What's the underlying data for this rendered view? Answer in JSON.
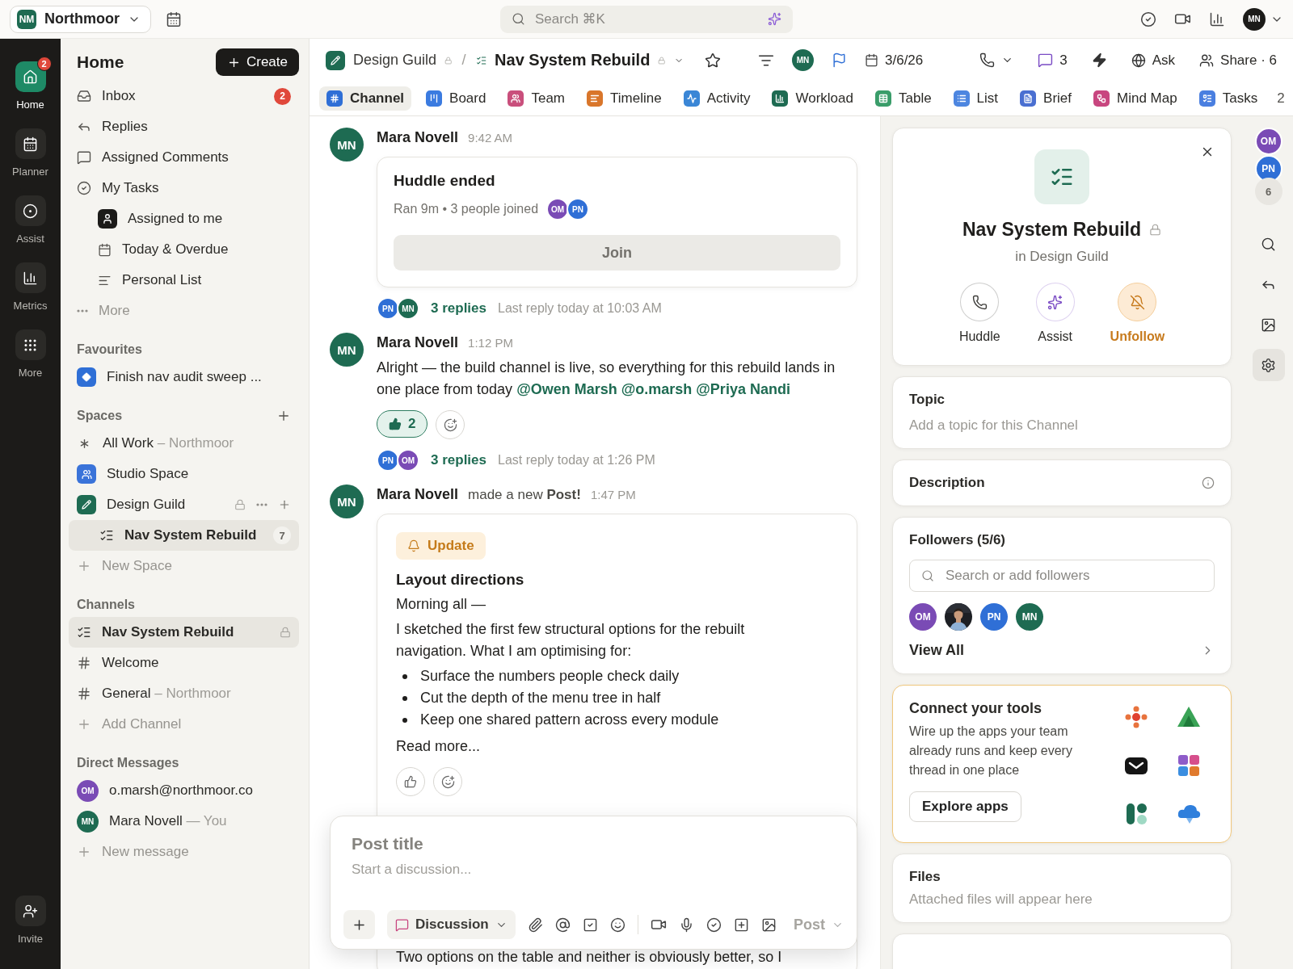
{
  "topbar": {
    "workspace_initials": "NM",
    "workspace_name": "Northmoor",
    "search_placeholder": "Search ⌘K",
    "user_initials": "MN"
  },
  "rail": {
    "items": [
      {
        "label": "Home",
        "selected": true,
        "badge": "2"
      },
      {
        "label": "Planner",
        "selected": false
      },
      {
        "label": "Assist",
        "selected": false
      },
      {
        "label": "Metrics",
        "selected": false
      },
      {
        "label": "More",
        "selected": false
      }
    ],
    "invite": "Invite"
  },
  "sidebar": {
    "title": "Home",
    "create": "Create",
    "nav": [
      {
        "label": "Inbox",
        "badge": "2"
      },
      {
        "label": "Replies"
      },
      {
        "label": "Assigned Comments"
      },
      {
        "label": "My Tasks",
        "children": [
          {
            "label": "Assigned to me"
          },
          {
            "label": "Today & Overdue"
          },
          {
            "label": "Personal List"
          }
        ]
      }
    ],
    "more": "More",
    "favourites": {
      "heading": "Favourites",
      "items": [
        {
          "label": "Finish nav audit sweep ...",
          "color": "#2f6fd6"
        }
      ]
    },
    "spaces": {
      "heading": "Spaces",
      "items": [
        {
          "kind": "all",
          "label": "All Work",
          "suffix": "– Northmoor",
          "selected": false
        },
        {
          "kind": "space",
          "label": "Studio Space",
          "color": "#3a73d9",
          "selected": false
        },
        {
          "kind": "space",
          "label": "Design Guild",
          "color": "#1e6b52",
          "locked": true,
          "selected": false,
          "children": [
            {
              "label": "Nav System Rebuild",
              "count": "7",
              "selected": true
            }
          ]
        }
      ],
      "add": "New Space"
    },
    "channels": {
      "heading": "Channels",
      "items": [
        {
          "kind": "list",
          "label": "Nav System Rebuild",
          "locked": true,
          "selected": true
        },
        {
          "kind": "hash",
          "label": "Welcome",
          "selected": false
        },
        {
          "kind": "hash",
          "label": "General",
          "suffix": "– Northmoor",
          "selected": false
        }
      ],
      "add": "Add Channel"
    },
    "direct_messages": {
      "heading": "Direct Messages",
      "items": [
        {
          "initials": "OM",
          "color": "#7a4bb5",
          "label": "o.marsh@northmoor.co"
        },
        {
          "initials": "MN",
          "color": "#1e6b52",
          "label": "Mara Novell",
          "suffix": "— You"
        }
      ],
      "add": "New message"
    }
  },
  "header": {
    "space": "Design Guild",
    "separator": "/",
    "channel": "Nav System Rebuild",
    "assignee": {
      "initials": "MN",
      "color": "#1e6b52"
    },
    "date": "3/6/26",
    "comments": "3",
    "ask": "Ask",
    "share": "Share · 6",
    "tabs": [
      {
        "label": "Channel",
        "color": "#2f6fd6",
        "selected": true
      },
      {
        "label": "Board",
        "color": "#3b7be0",
        "selected": false
      },
      {
        "label": "Team",
        "color": "#c94f7c",
        "selected": false
      },
      {
        "label": "Timeline",
        "color": "#d9762b",
        "selected": false
      },
      {
        "label": "Activity",
        "color": "#3a86d6",
        "selected": false
      },
      {
        "label": "Workload",
        "color": "#1e6b52",
        "selected": false
      },
      {
        "label": "Table",
        "color": "#3a9d6a",
        "selected": false
      },
      {
        "label": "List",
        "color": "#4d86e0",
        "selected": false
      },
      {
        "label": "Brief",
        "color": "#4a6fd1",
        "selected": false
      },
      {
        "label": "Mind Map",
        "color": "#c8467f",
        "selected": false
      },
      {
        "label": "Tasks",
        "color": "#4a7fe0",
        "selected": false
      }
    ],
    "overflow": "2"
  },
  "messages": [
    {
      "kind": "huddle",
      "author": "Mara Novell",
      "initials": "MN",
      "color": "#1e6b52",
      "time": "9:42 AM",
      "title": "Huddle ended",
      "meta": "Ran 9m • 3 people joined",
      "avatars": [
        {
          "initials": "OM",
          "color": "#7a4bb5"
        },
        {
          "initials": "PN",
          "color": "#2f6fd6"
        }
      ],
      "button": "Join",
      "thread": {
        "avatars": [
          {
            "initials": "PN",
            "color": "#2f6fd6"
          },
          {
            "initials": "MN",
            "color": "#1e6b52"
          }
        ],
        "replies": "3 replies",
        "last": "Last reply today at 10:03 AM"
      }
    },
    {
      "kind": "text",
      "author": "Mara Novell",
      "initials": "MN",
      "color": "#1e6b52",
      "time": "1:12 PM",
      "text": "Alright — the build channel is live, so everything for this rebuild lands in one place from today",
      "mentions": [
        "@Owen Marsh",
        "@o.marsh",
        "@Priya Nandi"
      ],
      "reactions": [
        {
          "count": "2",
          "selected": true
        }
      ],
      "thread": {
        "avatars": [
          {
            "initials": "PN",
            "color": "#2f6fd6"
          },
          {
            "initials": "OM",
            "color": "#7a4bb5"
          }
        ],
        "replies": "3 replies",
        "last": "Last reply today at 1:26 PM"
      }
    },
    {
      "kind": "post",
      "author": "Mara Novell",
      "initials": "MN",
      "color": "#1e6b52",
      "action": "made a new **Post!**",
      "time": "1:47 PM",
      "tag": "Update",
      "title": "Layout directions",
      "paragraphs": [
        "Morning all —",
        "I sketched the first few structural options for the rebuilt navigation. What I am optimising for:"
      ],
      "bullets": [
        "Surface the numbers people check daily",
        "Cut the depth of the menu tree in half",
        "Keep one shared pattern across every module"
      ],
      "read_more": "Read more...",
      "tail": "Two options on the table and neither is obviously better, so I"
    }
  ],
  "composer": {
    "title_placeholder": "Post title",
    "body_placeholder": "Start a discussion...",
    "type": "Discussion",
    "send": "Post"
  },
  "details": {
    "title": "Nav System Rebuild",
    "subtitle": "in Design Guild",
    "actions": [
      {
        "label": "Huddle",
        "color": "#3d3c39",
        "active": false
      },
      {
        "label": "Assist",
        "color": "#7a4bc4",
        "active": false
      },
      {
        "label": "Unfollow",
        "color": "#c77a1c",
        "active": true
      }
    ],
    "topic": {
      "heading": "Topic",
      "placeholder": "Add a topic for this Channel"
    },
    "description": {
      "heading": "Description"
    },
    "followers": {
      "heading": "Followers (5/6)",
      "search_placeholder": "Search or add followers",
      "avatars": [
        {
          "initials": "OM",
          "color": "#7a4bb5"
        },
        {
          "kind": "picture"
        },
        {
          "initials": "PN",
          "color": "#2f6fd6"
        },
        {
          "initials": "MN",
          "color": "#1e6b52"
        }
      ],
      "view_all": "View All"
    },
    "connect": {
      "heading": "Connect your tools",
      "text": "Wire up the apps your team already runs and keep every thread in one place",
      "button": "Explore apps"
    },
    "files": {
      "heading": "Files",
      "text": "Attached files will appear here"
    }
  },
  "far_rail": {
    "avatars": [
      {
        "initials": "OM",
        "color": "#7a4bb5"
      },
      {
        "initials": "PN",
        "color": "#2f6fd6"
      }
    ],
    "count": "6",
    "tools": [
      {
        "selected": false
      },
      {
        "selected": false
      },
      {
        "selected": false
      },
      {
        "selected": true
      }
    ]
  }
}
